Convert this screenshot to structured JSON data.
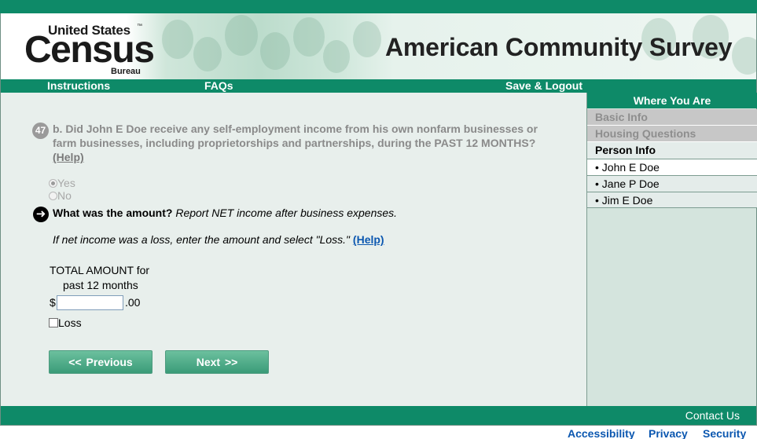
{
  "header": {
    "logo": {
      "line1": "United States",
      "tm": "™",
      "main": "Census",
      "bureau": "Bureau"
    },
    "title": "American Community Survey"
  },
  "nav": {
    "instructions": "Instructions",
    "faqs": "FAQs",
    "save_logout": "Save & Logout"
  },
  "question": {
    "number": "47",
    "text": "b. Did John E Doe receive any self-employment income from his own nonfarm businesses or farm businesses, including proprietorships and partnerships, during the PAST 12 MONTHS?",
    "help": "(Help)",
    "options": [
      {
        "label": "Yes",
        "selected": true
      },
      {
        "label": "No",
        "selected": false
      }
    ]
  },
  "amount": {
    "prompt_bold": "What was the amount?",
    "prompt_italic": " Report NET income after business expenses.",
    "loss_note": "If net income was a loss, enter the amount and select \"Loss.\"",
    "help": "(Help)",
    "total_label_line1": "TOTAL AMOUNT for",
    "total_label_line2": "past 12 months",
    "currency": "$",
    "value": "",
    "cents": ".00",
    "loss_label": "Loss",
    "loss_checked": false
  },
  "buttons": {
    "previous": "<<   Previous",
    "next": "Next   >>"
  },
  "sidebar": {
    "heading": "Where You Are",
    "sections": [
      "Basic Info",
      "Housing Questions"
    ],
    "current_section": "Person Info",
    "persons": [
      {
        "label": "• John E Doe",
        "current": true
      },
      {
        "label": "• Jane P Doe",
        "current": false
      },
      {
        "label": "• Jim E Doe",
        "current": false
      }
    ]
  },
  "footer": {
    "contact": "Contact Us",
    "links": [
      "Accessibility",
      "Privacy",
      "Security"
    ]
  },
  "colors": {
    "brand_green": "#0e8a68",
    "link_blue": "#0b57b0",
    "panel_bg": "#e8efec"
  }
}
